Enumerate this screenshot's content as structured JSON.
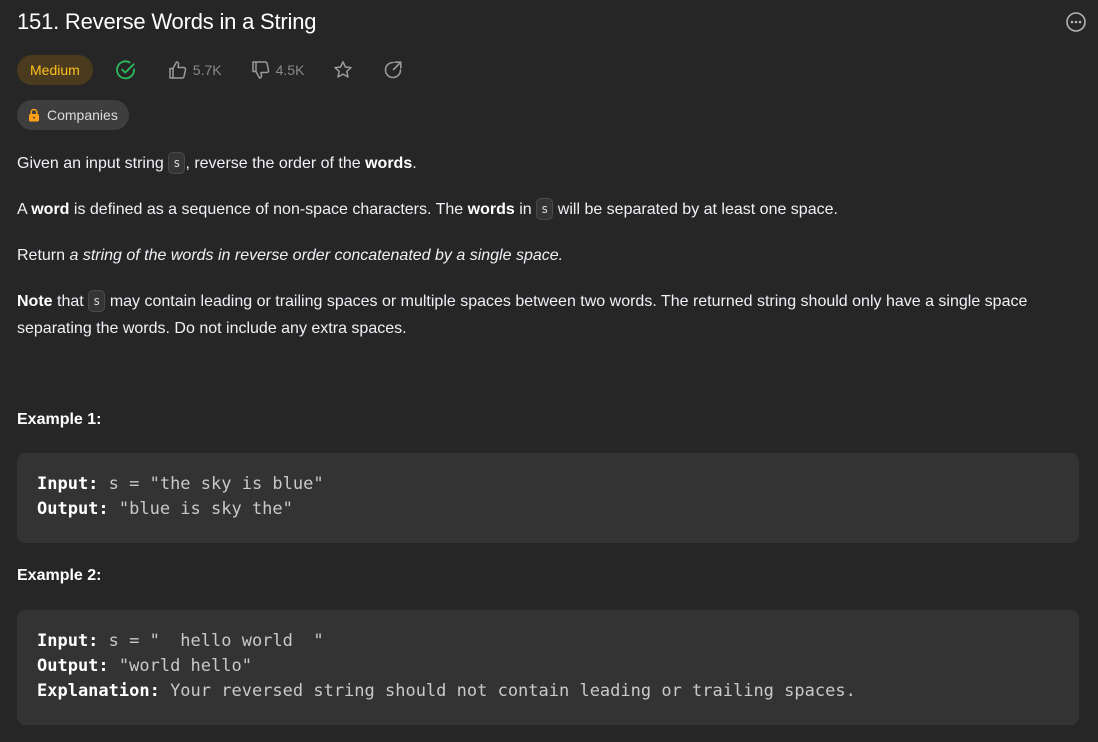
{
  "problem": {
    "title": "151. Reverse Words in a String",
    "difficulty": "Medium",
    "likes": "5.7K",
    "dislikes": "4.5K",
    "companies_label": "Companies"
  },
  "description": {
    "p1": {
      "a": "Given an input string ",
      "code": "s",
      "b": ", reverse the order of the ",
      "bold": "words",
      "c": "."
    },
    "p2": {
      "a": "A ",
      "bold1": "word",
      "b": " is defined as a sequence of non-space characters. The ",
      "bold2": "words",
      "c": " in ",
      "code": "s",
      "d": " will be separated by at least one space."
    },
    "p3": {
      "a": "Return ",
      "italic": "a string of the words in reverse order concatenated by a single space."
    },
    "p4": {
      "bold": "Note",
      "a": " that ",
      "code": "s",
      "b": " may contain leading or trailing spaces or multiple spaces between two words. The returned string should only have a single space separating the words. Do not include any extra spaces."
    }
  },
  "examples": [
    {
      "title": "Example 1:",
      "lines": [
        {
          "label": "Input:",
          "text": " s = \"the sky is blue\""
        },
        {
          "label": "Output:",
          "text": " \"blue is sky the\""
        }
      ]
    },
    {
      "title": "Example 2:",
      "lines": [
        {
          "label": "Input:",
          "text": " s = \"  hello world  \""
        },
        {
          "label": "Output:",
          "text": " \"world hello\""
        },
        {
          "label": "Explanation:",
          "text": " Your reversed string should not contain leading or trailing spaces."
        }
      ]
    }
  ],
  "colors": {
    "background": "#262626",
    "medium": "#ffc01e",
    "solved": "#2cbb5d",
    "icon": "#8a8a8a",
    "lock": "#ffa116"
  },
  "icons": {
    "more": "more-horizontal-circle-icon",
    "solved": "check-circle-icon",
    "like": "thumbs-up-icon",
    "dislike": "thumbs-down-icon",
    "star": "star-icon",
    "share": "share-icon",
    "lock": "lock-icon"
  }
}
